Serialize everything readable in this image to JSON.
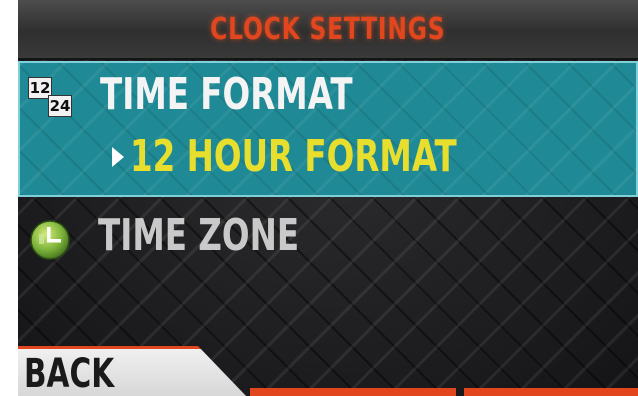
{
  "title": "CLOCK SETTINGS",
  "colors": {
    "title": "#e2461f",
    "selected_row": "#1f8a95",
    "selected_value": "#e8de2e",
    "accent": "#e2461f"
  },
  "menu": {
    "time_format": {
      "label": "TIME FORMAT",
      "icon": "12-24-format-icon",
      "icon_top": "12",
      "icon_bottom": "24",
      "selected_value": "12 HOUR FORMAT",
      "selected": true
    },
    "time_zone": {
      "label": "TIME ZONE",
      "icon": "globe-clock-icon",
      "selected": false
    }
  },
  "footer": {
    "back_label": "BACK"
  }
}
